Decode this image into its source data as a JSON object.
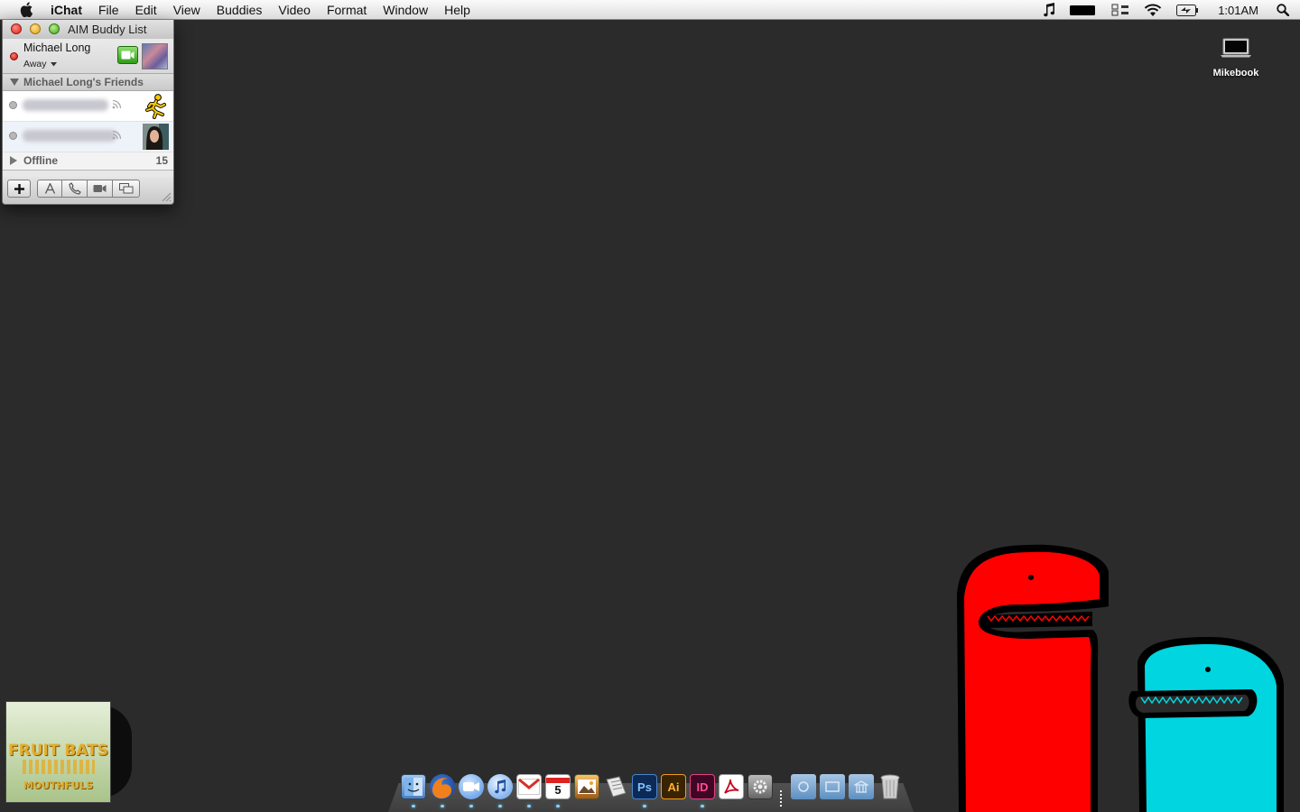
{
  "menubar": {
    "app_name": "iChat",
    "menus": [
      "File",
      "Edit",
      "View",
      "Buddies",
      "Video",
      "Format",
      "Window",
      "Help"
    ],
    "clock": "1:01AM",
    "status_icons": [
      "music-note-icon",
      "battery-bar-icon",
      "input-menu-icon",
      "wifi-icon",
      "battery-charging-icon",
      "spotlight-icon"
    ]
  },
  "buddy_window": {
    "title": "AIM Buddy List",
    "account": {
      "name": "Michael Long",
      "status": "Away"
    },
    "group": {
      "label": "Michael Long's Friends",
      "buddies": [
        {
          "name": "",
          "icon": "aim-running-man-icon"
        },
        {
          "name": "",
          "icon": "buddy-photo"
        }
      ]
    },
    "offline_group": {
      "label": "Offline",
      "count": "15"
    },
    "toolbar": [
      "add-buddy",
      "text-chat",
      "audio-chat",
      "video-chat",
      "screen-share"
    ]
  },
  "desktop": {
    "disk_label": "Mikebook",
    "album": {
      "line1": "FRUIT BATS",
      "line2": "MOUTHFULS"
    }
  },
  "dock": {
    "items": [
      "Finder",
      "Firefox",
      "iChat",
      "iTunes",
      "Gmail",
      "iCal",
      "iPhoto",
      "Script Editor",
      "Ps",
      "Ai",
      "ID",
      "Acrobat",
      "System Preferences",
      "Documents",
      "Folder",
      "Applications",
      "Trash"
    ],
    "labels": {
      "ps": "Ps",
      "ai": "Ai",
      "id": "ID",
      "cal_day": "5"
    }
  },
  "colors": {
    "desktop_bg": "#2b2b2b",
    "dino_red": "#ff0000",
    "dino_cyan": "#00d5e0"
  }
}
